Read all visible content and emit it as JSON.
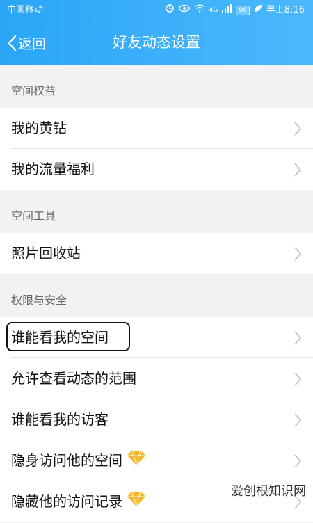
{
  "status": {
    "carrier": "中国移动",
    "network": "4G",
    "battery": "96",
    "time": "早上8:16"
  },
  "nav": {
    "back_label": "返回",
    "title": "好友动态设置"
  },
  "sections": [
    {
      "header": "空间权益",
      "items": [
        "我的黄钻",
        "我的流量福利"
      ]
    },
    {
      "header": "空间工具",
      "items": [
        "照片回收站"
      ]
    },
    {
      "header": "权限与安全",
      "items": [
        "谁能看我的空间",
        "允许查看动态的范围",
        "谁能看我的访客",
        "隐身访问他的空间",
        "隐藏他的访问记录"
      ]
    }
  ],
  "watermark": "爱创根知识网",
  "colors": {
    "header": "#34ABF9",
    "chevron": "#c4c4c4",
    "diamond": "#f7b52c"
  }
}
